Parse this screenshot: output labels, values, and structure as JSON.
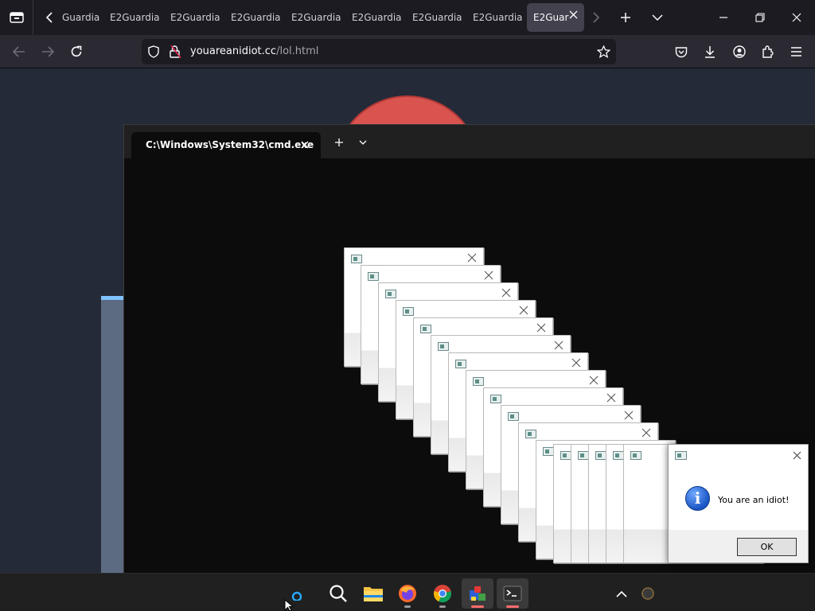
{
  "browser": {
    "tabs": [
      {
        "label": "Guardia"
      },
      {
        "label": "E2Guardia"
      },
      {
        "label": "E2Guardia"
      },
      {
        "label": "E2Guardia"
      },
      {
        "label": "E2Guardia"
      },
      {
        "label": "E2Guardia"
      },
      {
        "label": "E2Guardia"
      },
      {
        "label": "E2Guardia"
      },
      {
        "label": "E2Guar"
      }
    ],
    "url": {
      "host": "youareanidiot.cc",
      "path": "/lol.html"
    }
  },
  "terminal": {
    "tab_title": "C:\\Windows\\System32\\cmd.exe"
  },
  "dialog": {
    "message": "You are an idiot!",
    "ok_label": "OK"
  },
  "taskbar": {
    "items": [
      "start-icon",
      "search-icon",
      "file-explorer-icon",
      "firefox-icon",
      "chrome-icon",
      "app-icon",
      "terminal-icon"
    ],
    "tray": [
      "chevron-up-icon"
    ]
  },
  "colors": {
    "browser_bg": "#1c1b22",
    "navbar_bg": "#2b2a33",
    "page_bg": "#242a38",
    "terminal_bg": "#0c0c0c",
    "taskbar_bg": "#202020",
    "accent_red": "#d9534f"
  }
}
